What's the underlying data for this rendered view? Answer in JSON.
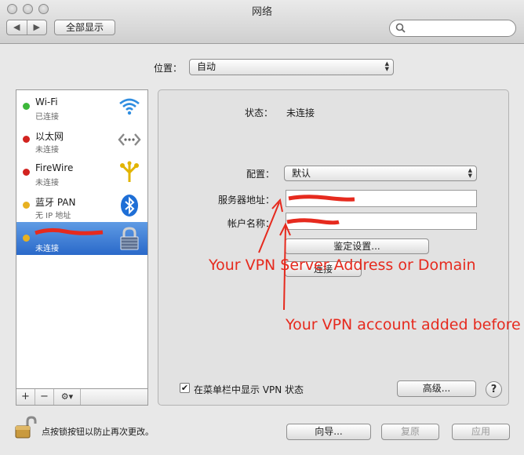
{
  "window": {
    "title": "网络"
  },
  "toolbar": {
    "back_label": "◀",
    "forward_label": "▶",
    "show_all_label": "全部显示",
    "search_placeholder": ""
  },
  "location": {
    "label": "位置：",
    "value": "自动"
  },
  "services": [
    {
      "name": "Wi-Fi",
      "status": "已连接",
      "dot": "#3cb83a",
      "icon": "wifi-icon"
    },
    {
      "name": "以太网",
      "status": "未连接",
      "dot": "#d2231f",
      "icon": "ethernet-icon"
    },
    {
      "name": "FireWire",
      "status": "未连接",
      "dot": "#d2231f",
      "icon": "firewire-icon"
    },
    {
      "name": "蓝牙 PAN",
      "status": "无 IP 地址",
      "dot": "#e8b120",
      "icon": "bluetooth-icon"
    },
    {
      "name": "",
      "status": "未连接",
      "dot": "#e8b120",
      "icon": "vpn-lock-icon",
      "selected": true
    }
  ],
  "sidebar_controls": {
    "add_label": "+",
    "remove_label": "−",
    "gear_label": "⚙▾"
  },
  "detail": {
    "status_label": "状态：",
    "status_value": "未连接",
    "config_label": "配置：",
    "config_value": "默认",
    "server_label": "服务器地址：",
    "account_label": "帐户名称：",
    "auth_button": "鉴定设置...",
    "connect_button": "连接",
    "show_vpn_checkbox": "在菜单栏中显示 VPN 状态",
    "show_vpn_checked": true,
    "advanced_button": "高级...",
    "help_label": "?"
  },
  "footer": {
    "lock_text": "点按锁按钮以防止再次更改。",
    "assist_button": "向导...",
    "revert_button": "复原",
    "apply_button": "应用"
  },
  "annotations": {
    "server_note": "Your VPN Server Address or Domain",
    "account_note": "Your VPN account added before"
  },
  "colors": {
    "annotation": "#e62a1e",
    "selection": "#3a78d4"
  }
}
